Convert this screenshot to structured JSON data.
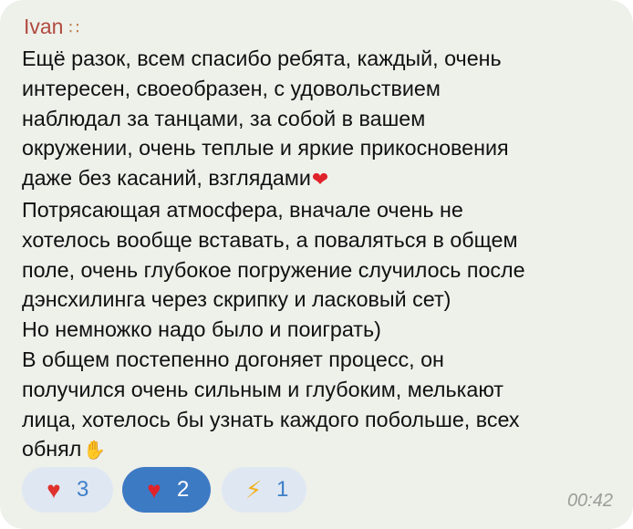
{
  "message": {
    "sender": "Ivan",
    "sender_icon": "footprints-icon",
    "lines": [
      "Ещё разок, всем спасибо ребята, каждый, очень",
      "интересен, своеобразен, с удовольствием",
      "наблюдал за танцами, за собой в вашем",
      "окружении, очень теплые и яркие прикосновения",
      "даже без касаний, взглядами",
      "Потрясающая атмосфера, вначале очень не",
      "хотелось вообще вставать, а поваляться в общем",
      "поле, очень глубокое погружение случилось после",
      "дэнсхилинга через скрипку и ласковый сет)",
      "Но немножко надо было и поиграть)",
      "В общем постепенно догоняет процесс, он",
      "получился очень сильным и глубоким, мелькают",
      "лица, хотелось бы узнать каждого побольше, всех",
      "обнял"
    ],
    "inline_emojis": {
      "after_line_5": "red-heart-emoji",
      "after_line_14": "pinched-fingers-emoji"
    },
    "time": "00:42"
  },
  "reactions": [
    {
      "icon": "heart-on-fire-icon",
      "count": "3",
      "selected": false
    },
    {
      "icon": "red-heart-icon",
      "count": "2",
      "selected": true
    },
    {
      "icon": "lightning-icon",
      "count": "1",
      "selected": false
    }
  ],
  "colors": {
    "bubble_bg": "#eef0ea",
    "sender_name": "#b04a3f",
    "reaction_bg": "#dfe7f2",
    "reaction_selected_bg": "#3d7ac4",
    "reaction_text": "#3e7fc8",
    "time_text": "#9a9e98"
  }
}
